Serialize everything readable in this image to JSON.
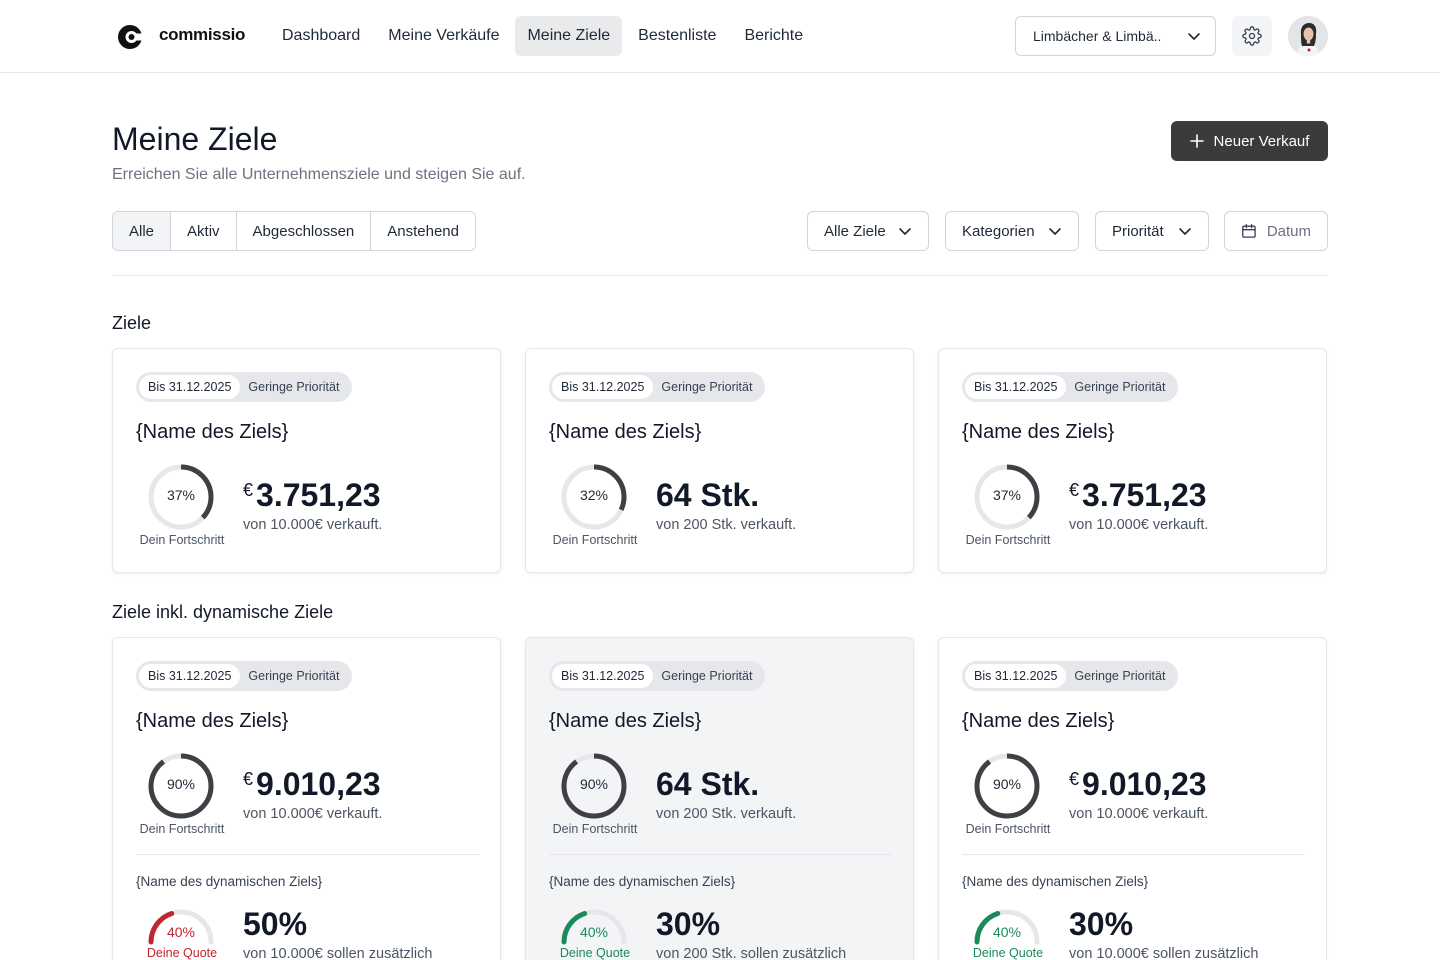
{
  "brand": {
    "name": "commissio"
  },
  "nav": {
    "items": [
      {
        "label": "Dashboard"
      },
      {
        "label": "Meine Verkäufe"
      },
      {
        "label": "Meine Ziele"
      },
      {
        "label": "Bestenliste"
      },
      {
        "label": "Berichte"
      }
    ],
    "active": "Meine Ziele",
    "company": "Limbächer & Limbä..",
    "settings_icon": "gear-icon",
    "avatar_icon": "user-avatar"
  },
  "header": {
    "title": "Meine Ziele",
    "subtitle": "Erreichen Sie alle Unternehmensziele und steigen Sie auf.",
    "new_button": "Neuer Verkauf"
  },
  "filters": {
    "tabs": [
      {
        "label": "Alle"
      },
      {
        "label": "Aktiv"
      },
      {
        "label": "Abgeschlossen"
      },
      {
        "label": "Anstehend"
      }
    ],
    "active_tab": "Alle",
    "goals_dropdown": "Alle Ziele",
    "categories_dropdown": "Kategorien",
    "priority_dropdown": "Priorität",
    "date_placeholder": "Datum"
  },
  "colors": {
    "accent": "#3b3b3b",
    "progress": "#3f3f46",
    "quota_red": "#c0262d",
    "quota_green": "#1a8a5a",
    "track": "#e5e7eb"
  },
  "sections": {
    "goals_title": "Ziele",
    "dynamic_title": "Ziele inkl. dynamische Ziele"
  },
  "goal_cards": [
    {
      "date": "Bis 31.12.2025",
      "priority": "Geringe Priorität",
      "name": "{Name des Ziels}",
      "progress_pct": 37,
      "progress_text": "37%",
      "progress_label": "Dein Fortschritt",
      "currency": "€",
      "value": "3.751,23",
      "sub": "von 10.000€ verkauft."
    },
    {
      "date": "Bis 31.12.2025",
      "priority": "Geringe Priorität",
      "name": "{Name des Ziels}",
      "progress_pct": 32,
      "progress_text": "32%",
      "progress_label": "Dein Fortschritt",
      "currency": "",
      "value": "64 Stk.",
      "sub": "von 200 Stk. verkauft."
    },
    {
      "date": "Bis 31.12.2025",
      "priority": "Geringe Priorität",
      "name": "{Name des Ziels}",
      "progress_pct": 37,
      "progress_text": "37%",
      "progress_label": "Dein Fortschritt",
      "currency": "€",
      "value": "3.751,23",
      "sub": "von 10.000€ verkauft."
    }
  ],
  "dynamic_cards": [
    {
      "date": "Bis 31.12.2025",
      "priority": "Geringe Priorität",
      "name": "{Name des Ziels}",
      "progress_pct": 90,
      "progress_text": "90%",
      "progress_label": "Dein Fortschritt",
      "currency": "€",
      "value": "9.010,23",
      "sub": "von 10.000€ verkauft.",
      "dyn_name": "{Name des dynamischen Ziels}",
      "quota_pct": 40,
      "quota_text": "40%",
      "quota_label": "Deine Quote",
      "quota_color": "#c0262d",
      "dyn_value": "50%",
      "dyn_sub": "von 10.000€ sollen zusätzlich"
    },
    {
      "date": "Bis 31.12.2025",
      "priority": "Geringe Priorität",
      "name": "{Name des Ziels}",
      "progress_pct": 90,
      "progress_text": "90%",
      "progress_label": "Dein Fortschritt",
      "currency": "",
      "value": "64 Stk.",
      "sub": "von 200 Stk. verkauft.",
      "dyn_name": "{Name des dynamischen Ziels}",
      "quota_pct": 40,
      "quota_text": "40%",
      "quota_label": "Deine Quote",
      "quota_color": "#1a8a5a",
      "dyn_value": "30%",
      "dyn_sub": "von 200 Stk. sollen zusätzlich"
    },
    {
      "date": "Bis 31.12.2025",
      "priority": "Geringe Priorität",
      "name": "{Name des Ziels}",
      "progress_pct": 90,
      "progress_text": "90%",
      "progress_label": "Dein Fortschritt",
      "currency": "€",
      "value": "9.010,23",
      "sub": "von 10.000€ verkauft.",
      "dyn_name": "{Name des dynamischen Ziels}",
      "quota_pct": 40,
      "quota_text": "40%",
      "quota_label": "Deine Quote",
      "quota_color": "#1a8a5a",
      "dyn_value": "30%",
      "dyn_sub": "von 10.000€ sollen zusätzlich"
    }
  ]
}
